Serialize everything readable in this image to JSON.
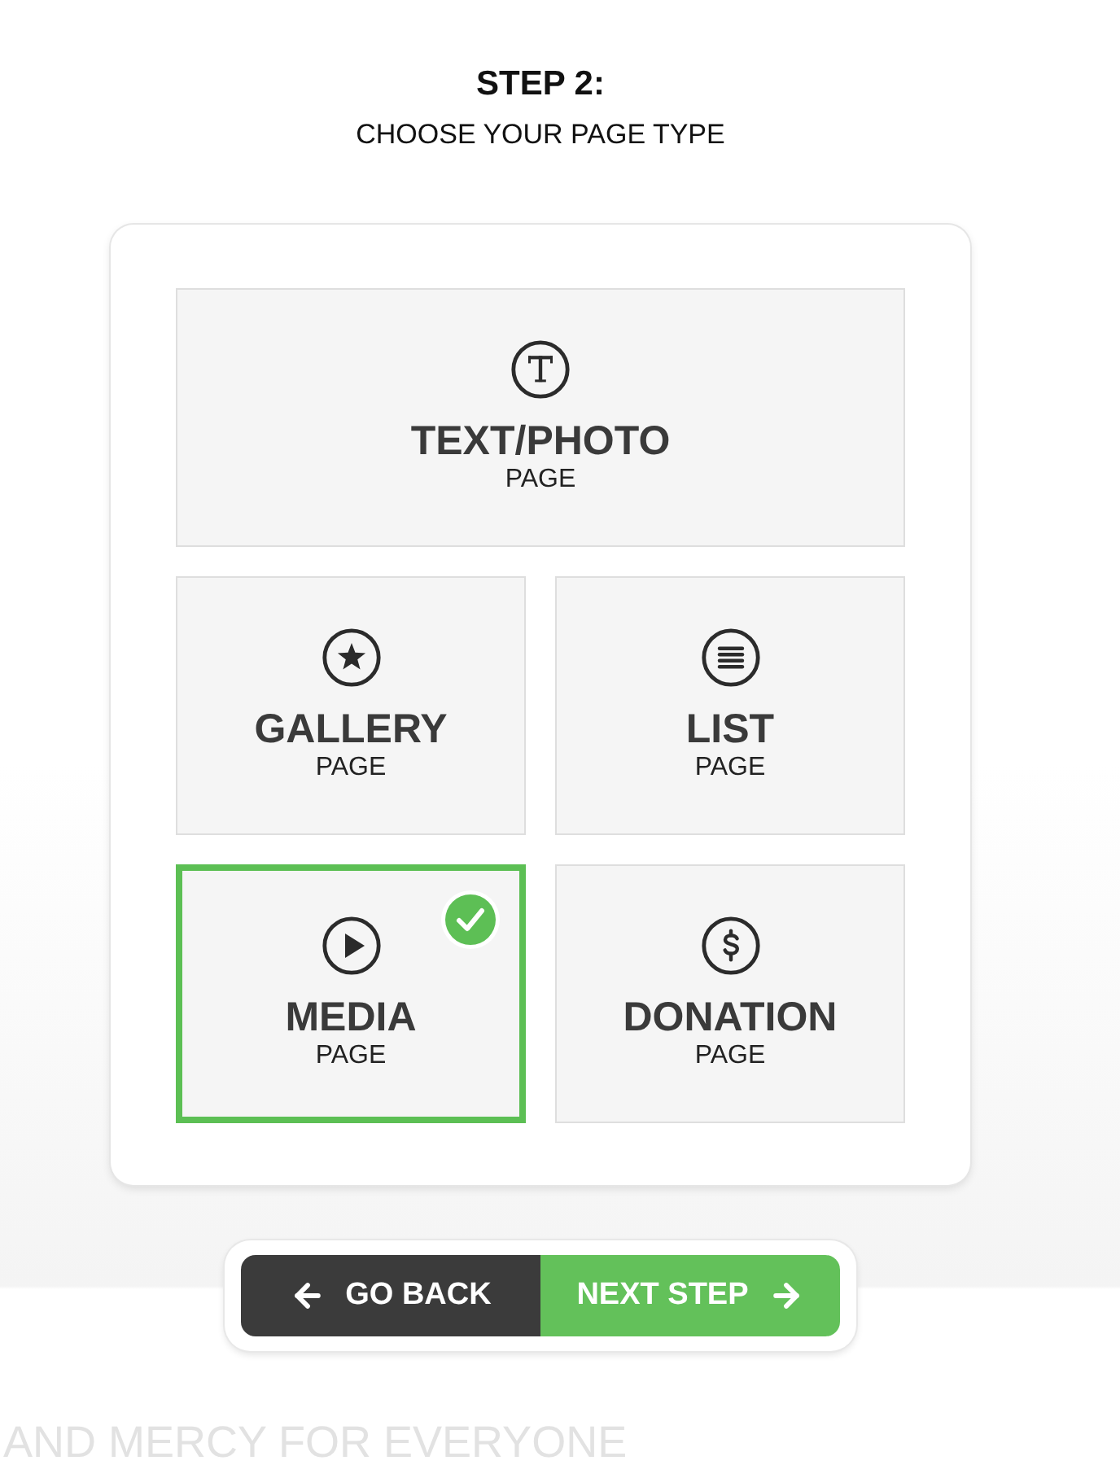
{
  "header": {
    "step": "STEP 2:",
    "subtitle": "CHOOSE YOUR PAGE TYPE"
  },
  "page_types": [
    {
      "kind": "text",
      "title": "TEXT/PHOTO",
      "subtitle": "PAGE",
      "selected": false
    },
    {
      "kind": "gallery",
      "title": "GALLERY",
      "subtitle": "PAGE",
      "selected": false
    },
    {
      "kind": "list",
      "title": "LIST",
      "subtitle": "PAGE",
      "selected": false
    },
    {
      "kind": "media",
      "title": "MEDIA",
      "subtitle": "PAGE",
      "selected": true
    },
    {
      "kind": "donation",
      "title": "DONATION",
      "subtitle": "PAGE",
      "selected": false
    }
  ],
  "buttons": [
    {
      "kind": "back",
      "label": "GO BACK"
    },
    {
      "kind": "next",
      "label": "NEXT STEP"
    }
  ],
  "footer_text": "AND MERCY FOR EVERYONE"
}
